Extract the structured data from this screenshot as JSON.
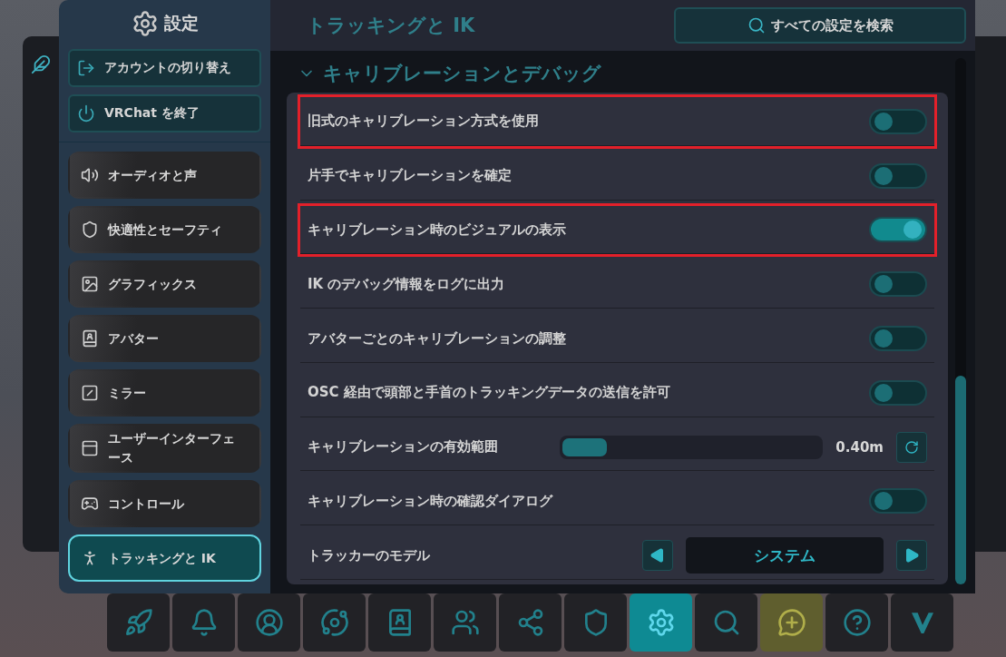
{
  "sidebar": {
    "title": "設定",
    "actions": [
      {
        "kind": "exit",
        "label": "アカウントの切り替え"
      },
      {
        "kind": "power",
        "label": "VRChat を終了"
      }
    ],
    "items": [
      {
        "kind": "audio",
        "label": "オーディオと声",
        "selected": false
      },
      {
        "kind": "shield",
        "label": "快適性とセーフティ",
        "selected": false
      },
      {
        "kind": "image",
        "label": "グラフィックス",
        "selected": false
      },
      {
        "kind": "avatar",
        "label": "アバター",
        "selected": false
      },
      {
        "kind": "mirror",
        "label": "ミラー",
        "selected": false
      },
      {
        "kind": "ui",
        "label": "ユーザーインターフェース",
        "selected": false
      },
      {
        "kind": "gamepad",
        "label": "コントロール",
        "selected": false
      },
      {
        "kind": "person",
        "label": "トラッキングと IK",
        "selected": true
      }
    ]
  },
  "page": {
    "title": "トラッキングと IK",
    "search_button": "すべての設定を検索",
    "section": {
      "title": "キャリブレーションとデバッグ",
      "expanded": true
    },
    "rows": [
      {
        "kind": "toggle",
        "label": "旧式のキャリブレーション方式を使用",
        "on": false,
        "highlighted": true
      },
      {
        "kind": "toggle",
        "label": "片手でキャリブレーションを確定",
        "on": false,
        "highlighted": false
      },
      {
        "kind": "toggle",
        "label": "キャリブレーション時のビジュアルの表示",
        "on": true,
        "highlighted": true
      },
      {
        "kind": "toggle",
        "label": "IK のデバッグ情報をログに出力",
        "on": false,
        "highlighted": false
      },
      {
        "kind": "toggle",
        "label": "アバターごとのキャリブレーションの調整",
        "on": false,
        "highlighted": false
      },
      {
        "kind": "toggle",
        "label": "OSC 経由で頭部と手首のトラッキングデータの送信を許可",
        "on": false,
        "highlighted": false
      },
      {
        "kind": "slider",
        "label": "キャリブレーションの有効範囲",
        "level": 0.17,
        "reading": "0.40m",
        "highlighted": false
      },
      {
        "kind": "toggle",
        "label": "キャリブレーション時の確認ダイアログ",
        "on": false,
        "highlighted": false
      },
      {
        "kind": "selector",
        "label": "トラッカーのモデル",
        "value": "システム",
        "highlighted": false
      }
    ]
  },
  "dock": [
    {
      "kind": "rocket",
      "selected": false
    },
    {
      "kind": "bell",
      "selected": false
    },
    {
      "kind": "profile",
      "selected": false
    },
    {
      "kind": "planet",
      "selected": false
    },
    {
      "kind": "avatar",
      "selected": false
    },
    {
      "kind": "people",
      "selected": false
    },
    {
      "kind": "network",
      "selected": false
    },
    {
      "kind": "shield",
      "selected": false
    },
    {
      "kind": "gear",
      "selected": true
    },
    {
      "kind": "search",
      "selected": false
    },
    {
      "kind": "chat",
      "selected": false,
      "color": "#5f5e2e"
    },
    {
      "kind": "help",
      "selected": false
    },
    {
      "kind": "logo",
      "selected": false
    }
  ]
}
